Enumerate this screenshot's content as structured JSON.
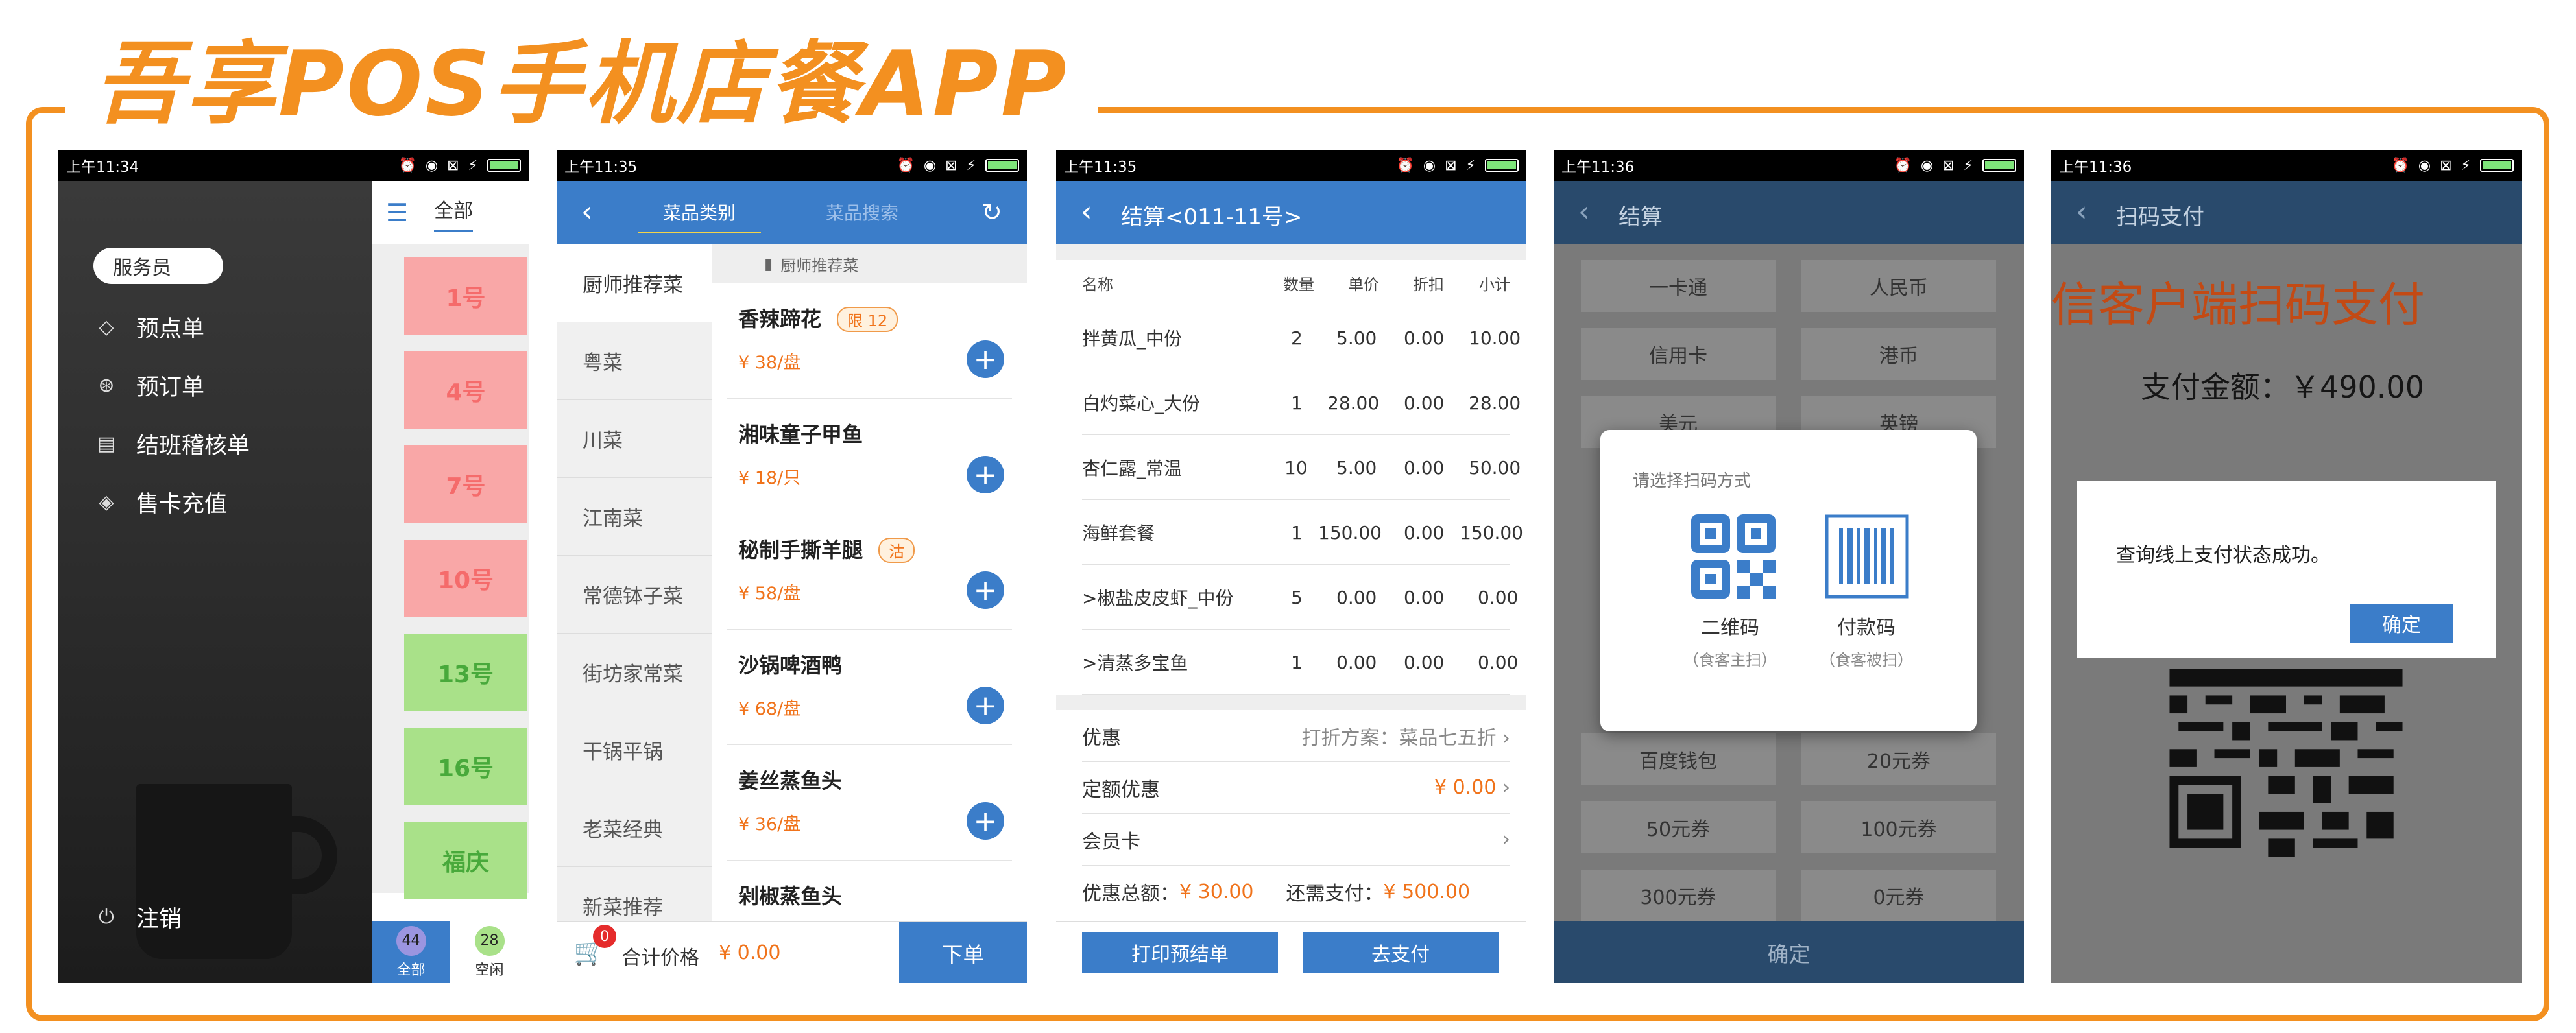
{
  "page": {
    "title": "吾享POS手机店餐APP",
    "accent": "#f39020",
    "primary": "#3b7dc9"
  },
  "p1": {
    "time": "上午11:34",
    "role": "服务员",
    "menu": [
      {
        "label": "预点单",
        "icon": "tag-icon"
      },
      {
        "label": "预订单",
        "icon": "yen-icon"
      },
      {
        "label": "结班稽核单",
        "icon": "document-icon"
      },
      {
        "label": "售卡充值",
        "icon": "diamond-icon"
      }
    ],
    "logout": "注销",
    "tab_all": "全部",
    "tables": [
      "1号",
      "4号",
      "7号",
      "10号",
      "13号",
      "16号",
      "福庆"
    ],
    "table_status": [
      "pink",
      "pink",
      "pink",
      "pink",
      "green",
      "green",
      "green"
    ],
    "bottom": [
      {
        "count": "44",
        "label": "全部"
      },
      {
        "count": "28",
        "label": "空闲"
      }
    ]
  },
  "p2": {
    "time": "上午11:35",
    "tabs": [
      "菜品类别",
      "菜品搜索"
    ],
    "categories": [
      "厨师推荐菜",
      "粤菜",
      "川菜",
      "江南菜",
      "常德钵子菜",
      "街坊家常菜",
      "干锅平锅",
      "老菜经典",
      "新菜推荐"
    ],
    "section": "厨师推荐菜",
    "dishes": [
      {
        "name": "香辣蹄花",
        "price": "¥ 38/盘",
        "tag": "限 12"
      },
      {
        "name": "湘味童子甲鱼",
        "price": "¥ 18/只",
        "tag": ""
      },
      {
        "name": "秘制手撕羊腿",
        "price": "¥ 58/盘",
        "tag": "沽"
      },
      {
        "name": "沙锅啤酒鸭",
        "price": "¥ 68/盘",
        "tag": ""
      },
      {
        "name": "姜丝蒸鱼头",
        "price": "¥ 36/盘",
        "tag": ""
      },
      {
        "name": "剁椒蒸鱼头",
        "price": "",
        "tag": ""
      }
    ],
    "cart_badge": "0",
    "total_label": "合计价格",
    "total_value": "¥ 0.00",
    "order_btn": "下单"
  },
  "p3": {
    "time": "上午11:35",
    "title": "结算<011-11号>",
    "headers": [
      "名称",
      "数量",
      "单价",
      "折扣",
      "小计"
    ],
    "rows": [
      [
        "拌黄瓜_中份",
        "2",
        "5.00",
        "0.00",
        "10.00"
      ],
      [
        "白灼菜心_大份",
        "1",
        "28.00",
        "0.00",
        "28.00"
      ],
      [
        "杏仁露_常温",
        "10",
        "5.00",
        "0.00",
        "50.00"
      ],
      [
        "海鲜套餐",
        "1",
        "150.00",
        "0.00",
        "150.00"
      ],
      [
        ">椒盐皮皮虾_中份",
        "5",
        "0.00",
        "0.00",
        "0.00"
      ],
      [
        ">清蒸多宝鱼",
        "1",
        "0.00",
        "0.00",
        "0.00"
      ]
    ],
    "discount_label": "优惠",
    "discount_value": "打折方案：菜品七五折",
    "fixed_label": "定额优惠",
    "fixed_value": "¥ 0.00",
    "member_label": "会员卡",
    "total_disc_label": "优惠总额：",
    "total_disc_value": "¥ 30.00",
    "need_pay_label": "还需支付：",
    "need_pay_value": "¥ 500.00",
    "print_btn": "打印预结单",
    "pay_btn": "去支付"
  },
  "p4": {
    "time": "上午11:36",
    "title": "结算",
    "methods": [
      "一卡通",
      "人民币",
      "信用卡",
      "港币",
      "美元",
      "英镑",
      "百度钱包",
      "20元券",
      "50元券",
      "100元券",
      "300元券",
      "0元券"
    ],
    "dialog_title": "请选择扫码方式",
    "qr_label": "二维码",
    "qr_sub": "（食客主扫）",
    "barcode_label": "付款码",
    "barcode_sub": "（食客被扫）",
    "confirm": "确定"
  },
  "p5": {
    "time": "上午11:36",
    "title": "扫码支付",
    "heading": "信客户端扫码支付",
    "amount": "支付金额：￥490.00",
    "dialog_text": "查询线上支付状态成功。",
    "ok": "确定"
  }
}
